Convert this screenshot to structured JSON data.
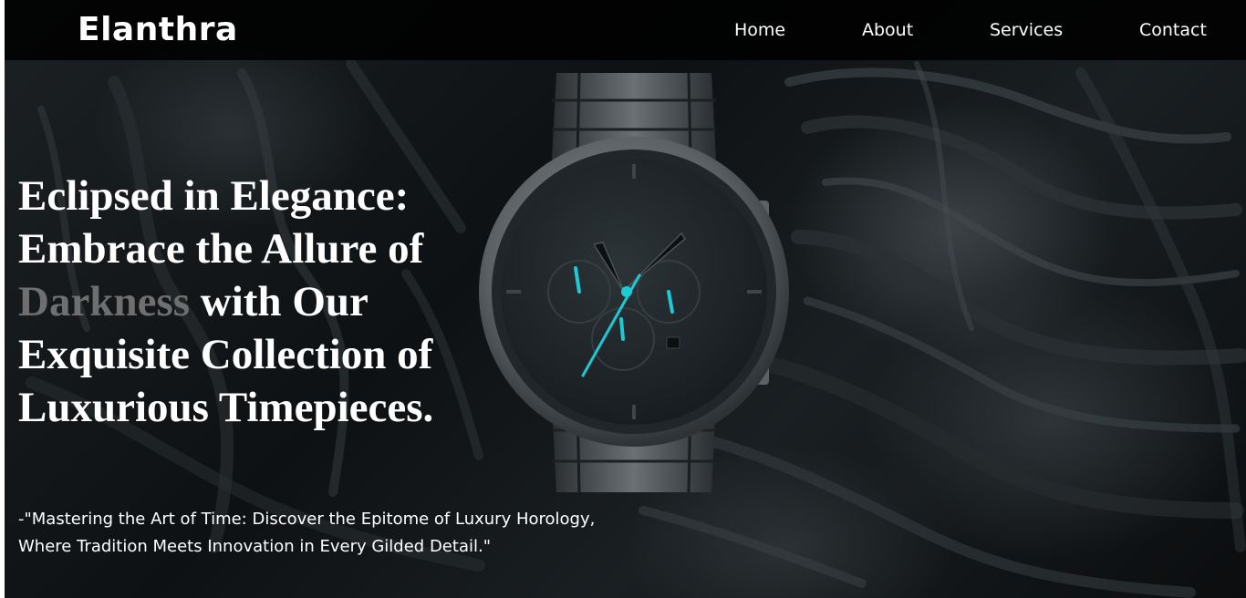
{
  "brand": {
    "name": "Elanthra"
  },
  "nav": {
    "items": [
      {
        "label": "Home"
      },
      {
        "label": "About"
      },
      {
        "label": "Services"
      },
      {
        "label": "Contact"
      }
    ]
  },
  "hero": {
    "headline": {
      "line1": "Eclipsed in Elegance:",
      "line2": "Embrace the Allure of",
      "accent_word": "Darkness",
      "line3_rest": " with Our",
      "line4": "Exquisite Collection of",
      "line5": "Luxurious Timepieces."
    },
    "tagline": {
      "line1": "-\"Mastering the Art of Time: Discover the Epitome of Luxury Horology,",
      "line2": "Where Tradition Meets Innovation in Every Gilded Detail.\""
    }
  },
  "colors": {
    "nav_background": "#000000",
    "text": "#ffffff",
    "accent_word": "#6f6f6f",
    "watch_hands_accent": "#1ec8d4"
  },
  "icons": {
    "hero_image": "wristwatch-on-dark-rock"
  }
}
